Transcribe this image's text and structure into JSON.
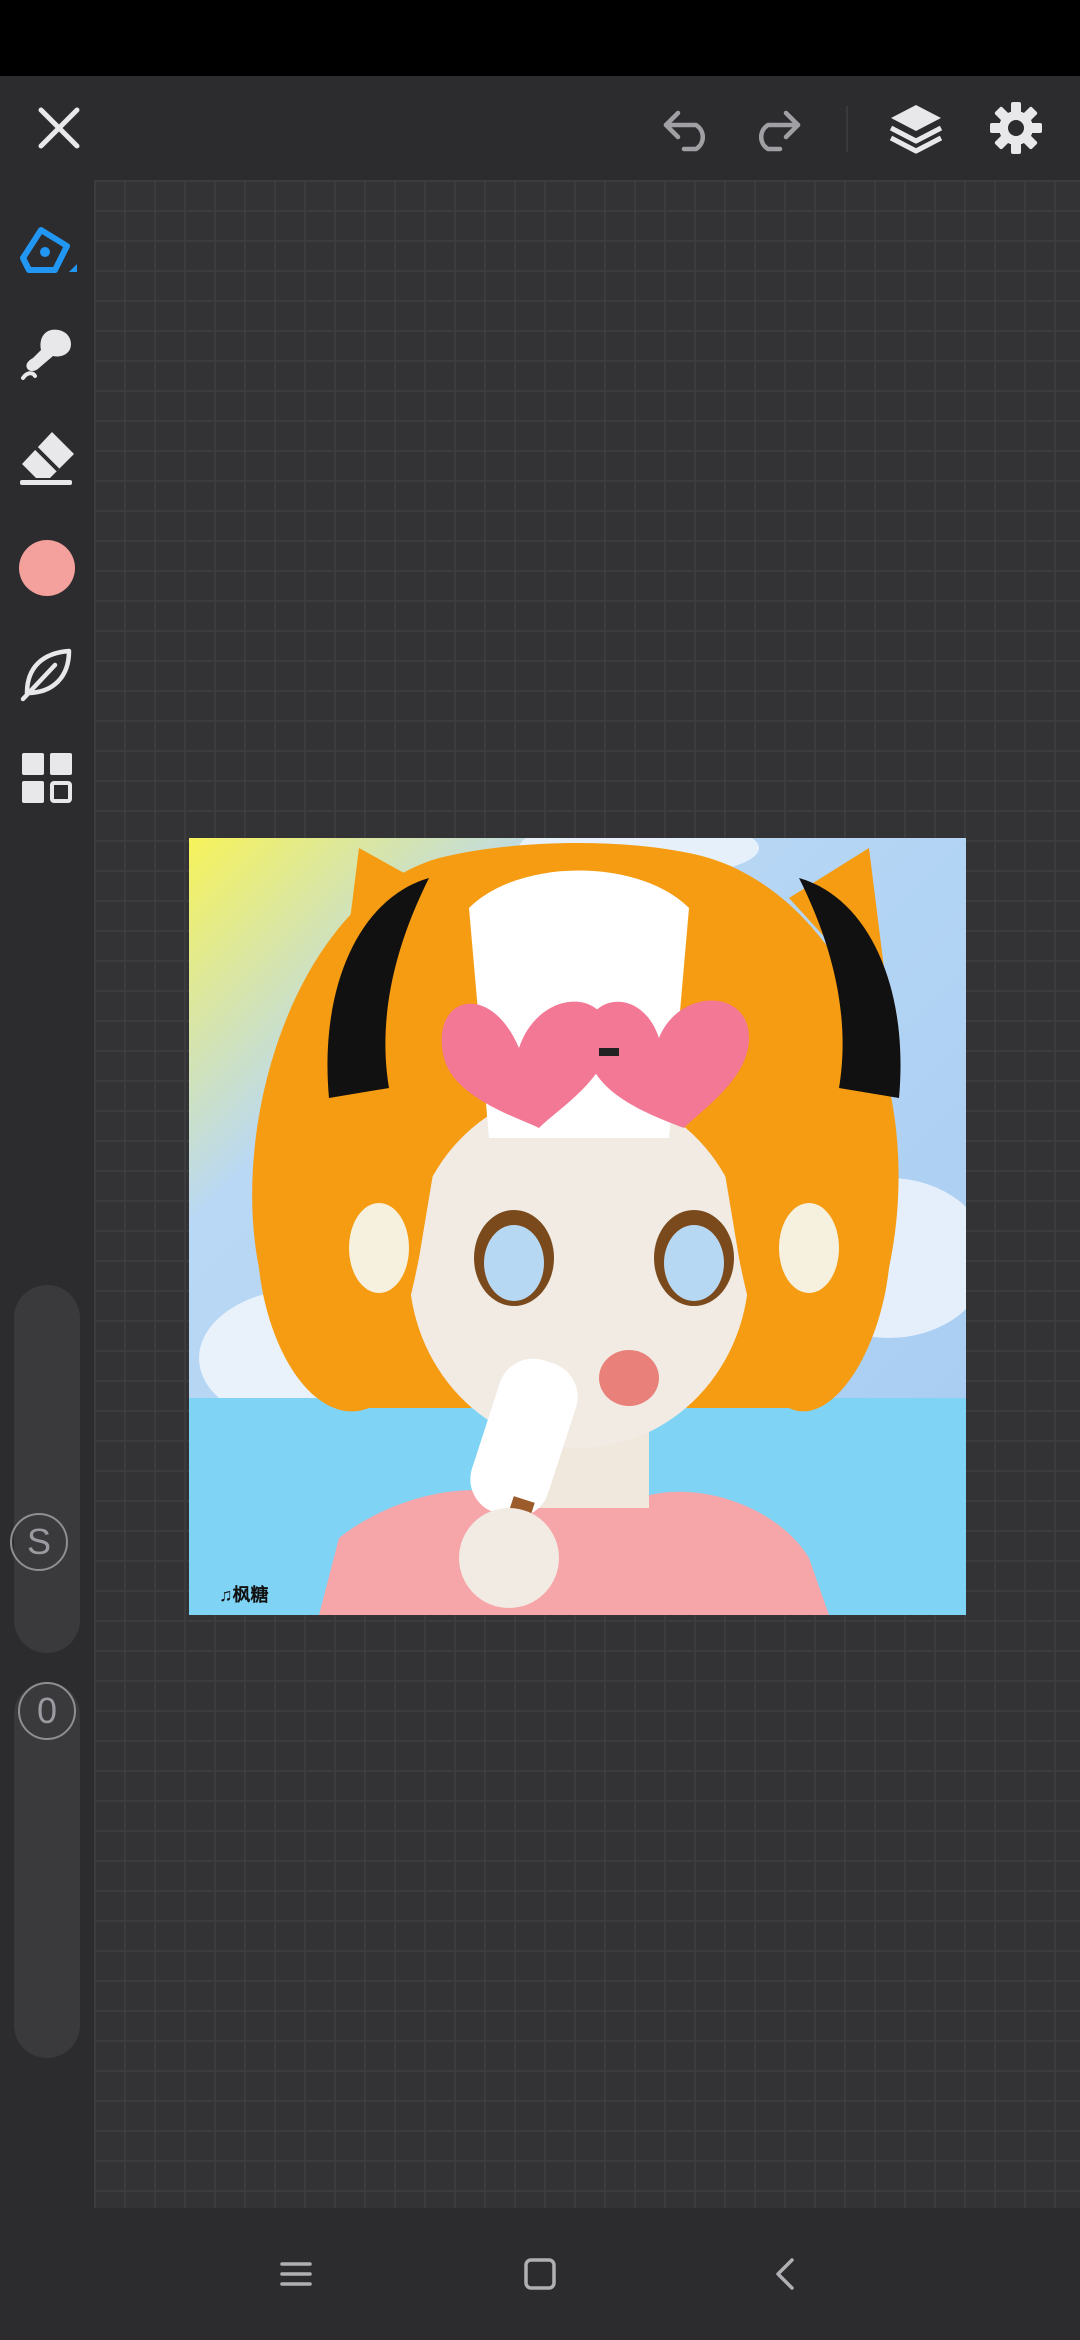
{
  "toolbar": {
    "icons": [
      "close-icon",
      "undo-icon",
      "redo-icon",
      "layers-icon",
      "settings-icon"
    ]
  },
  "sidebar": {
    "tools": [
      "pen-icon",
      "smudge-icon",
      "eraser-icon",
      "color-swatch",
      "leaf-icon",
      "grid-icon"
    ],
    "current_color": "#f4a09c",
    "accent_color": "#2196f3",
    "size_slider_label": "S",
    "opacity_slider_label": "0"
  },
  "canvas": {
    "watermark": "♫枫糖"
  },
  "navbar": {
    "icons": [
      "menu-icon",
      "home-icon",
      "back-icon"
    ]
  }
}
